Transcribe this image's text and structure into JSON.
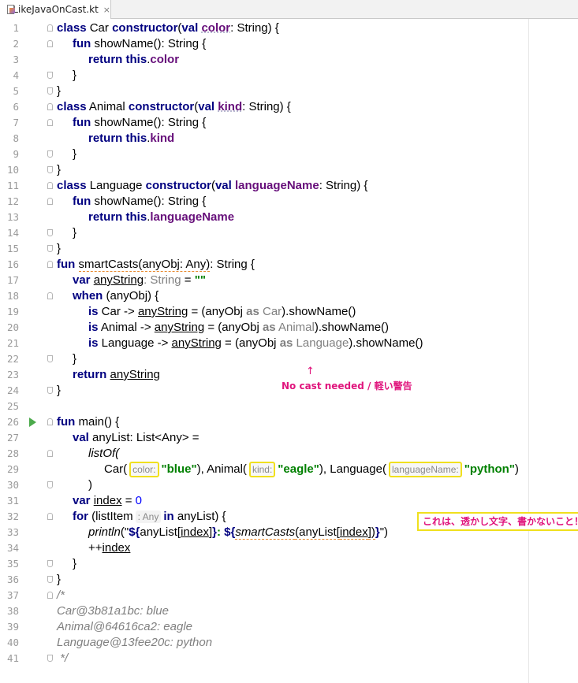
{
  "tab": {
    "filename": "LikeJavaOnCast.kt",
    "close": "×"
  },
  "annotations": {
    "arrow": "↑",
    "warning_note": "No cast needed / 軽い警告",
    "watermark_note": "これは、透かし文字、書かないこと！"
  },
  "hints": {
    "color": "color:",
    "kind": "kind:",
    "languageName": "languageName:",
    "listItemType": ": Any"
  },
  "lines": [
    "1",
    "2",
    "3",
    "4",
    "5",
    "6",
    "7",
    "8",
    "9",
    "10",
    "11",
    "12",
    "13",
    "14",
    "15",
    "16",
    "17",
    "18",
    "19",
    "20",
    "21",
    "22",
    "23",
    "24",
    "25",
    "26",
    "27",
    "28",
    "29",
    "30",
    "31",
    "32",
    "33",
    "34",
    "35",
    "36",
    "37",
    "38",
    "39",
    "40",
    "41"
  ],
  "code": {
    "l1": [
      "class",
      " Car ",
      "constructor",
      "(",
      "val",
      " ",
      "color",
      ": String) {"
    ],
    "l2": [
      "fun",
      " showName(): String {"
    ],
    "l3": [
      "return",
      " ",
      "this",
      ".",
      "color"
    ],
    "l4": "}",
    "l5": "}",
    "l6": [
      "class",
      " Animal ",
      "constructor",
      "(",
      "val",
      " ",
      "kind",
      ": String) {"
    ],
    "l7": [
      "fun",
      " showName(): String {"
    ],
    "l8": [
      "return",
      " ",
      "this",
      ".",
      "kind"
    ],
    "l9": "}",
    "l10": "}",
    "l11": [
      "class",
      " Language ",
      "constructor",
      "(",
      "val",
      " ",
      "languageName",
      ": String) {"
    ],
    "l12": [
      "fun",
      " showName(): String {"
    ],
    "l13": [
      "return",
      " ",
      "this",
      ".",
      "languageName"
    ],
    "l14": "}",
    "l15": "}",
    "l16": [
      "fun",
      " ",
      "smartCasts(anyObj: Any)",
      ": String {"
    ],
    "l17": [
      "var",
      " ",
      "anyString",
      ": String",
      " = ",
      "\"\""
    ],
    "l18": [
      "when",
      " (anyObj) {"
    ],
    "l19": [
      "is",
      " Car -> ",
      "anyString",
      " = (anyObj ",
      "as",
      " Car",
      ").showName()"
    ],
    "l20": [
      "is",
      " Animal -> ",
      "anyString",
      " = (anyObj ",
      "as",
      " Animal",
      ").showName()"
    ],
    "l21": [
      "is",
      " Language -> ",
      "anyString",
      " = (anyObj ",
      "as",
      " Language",
      ").showName()"
    ],
    "l22": "}",
    "l23": [
      "return",
      " ",
      "anyString"
    ],
    "l24": "}",
    "l26": [
      "fun",
      " main() {"
    ],
    "l27": [
      "val",
      " anyList: List<Any> ="
    ],
    "l28": "listOf(",
    "l29": [
      "Car(",
      "\"blue\"",
      "), Animal(",
      "\"eagle\"",
      "), Language(",
      "\"python\"",
      ")"
    ],
    "l30": ")",
    "l31": [
      "var",
      " ",
      "index",
      " = ",
      "0"
    ],
    "l32": [
      "for",
      " (listItem",
      "in",
      " anyList) {"
    ],
    "l33": [
      "println",
      "(\"",
      "${",
      "anyList[",
      "index",
      "]",
      "}",
      ": ",
      "${",
      "smartCasts",
      "(anyList[",
      "index",
      "])",
      "}",
      "\")"
    ],
    "l34": [
      "++",
      "index"
    ],
    "l35": "}",
    "l36": "}",
    "l37": "/*",
    "l38": "Car@3b81a1bc: blue",
    "l39": "Animal@64616ca2: eagle",
    "l40": "Language@13fee20c: python",
    "l41": " */"
  }
}
